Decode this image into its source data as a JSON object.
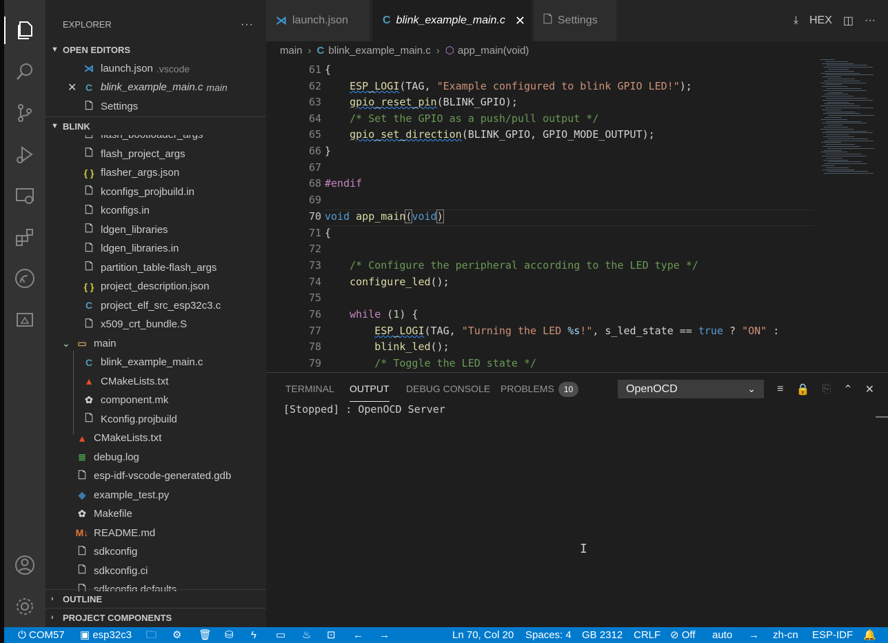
{
  "explorer": {
    "title": "EXPLORER",
    "more": "···"
  },
  "open_editors": {
    "header": "OPEN EDITORS",
    "items": [
      {
        "name": "launch.json",
        "detail": ".vscode"
      },
      {
        "name": "blink_example_main.c",
        "detail": "main"
      },
      {
        "name": "Settings",
        "detail": ""
      }
    ]
  },
  "blink": {
    "header": "BLINK",
    "items": [
      {
        "name": "flash_bootloader_args",
        "icon": "file-icon"
      },
      {
        "name": "flash_project_args",
        "icon": "file-icon"
      },
      {
        "name": "flasher_args.json",
        "icon": "json-icon"
      },
      {
        "name": "kconfigs_projbuild.in",
        "icon": "file-icon"
      },
      {
        "name": "kconfigs.in",
        "icon": "file-icon"
      },
      {
        "name": "ldgen_libraries",
        "icon": "file-icon"
      },
      {
        "name": "ldgen_libraries.in",
        "icon": "file-icon"
      },
      {
        "name": "partition_table-flash_args",
        "icon": "file-icon"
      },
      {
        "name": "project_description.json",
        "icon": "json-icon"
      },
      {
        "name": "project_elf_src_esp32c3.c",
        "icon": "c-icon"
      },
      {
        "name": "x509_crt_bundle.S",
        "icon": "file-icon"
      },
      {
        "name": "main",
        "icon": "folder-icon"
      },
      {
        "name": "blink_example_main.c",
        "icon": "c-icon"
      },
      {
        "name": "CMakeLists.txt",
        "icon": "cmake-icon"
      },
      {
        "name": "component.mk",
        "icon": "make-icon"
      },
      {
        "name": "Kconfig.projbuild",
        "icon": "file-icon"
      },
      {
        "name": "CMakeLists.txt",
        "icon": "cmake-icon"
      },
      {
        "name": "debug.log",
        "icon": "log-icon"
      },
      {
        "name": "esp-idf-vscode-generated.gdb",
        "icon": "file-icon"
      },
      {
        "name": "example_test.py",
        "icon": "python-icon"
      },
      {
        "name": "Makefile",
        "icon": "make-icon"
      },
      {
        "name": "README.md",
        "icon": "markdown-icon"
      },
      {
        "name": "sdkconfig",
        "icon": "file-icon"
      },
      {
        "name": "sdkconfig.ci",
        "icon": "file-icon"
      },
      {
        "name": "sdkconfig.defaults",
        "icon": "file-icon"
      }
    ]
  },
  "outline": {
    "header": "OUTLINE"
  },
  "project_components": {
    "header": "PROJECT COMPONENTS"
  },
  "tabs": [
    {
      "label": "launch.json"
    },
    {
      "label": "blink_example_main.c",
      "close": "✕"
    },
    {
      "label": "Settings"
    }
  ],
  "tab_actions": {
    "hex": "HEX",
    "more": "···"
  },
  "breadcrumbs": {
    "folder": "main",
    "file": "blink_example_main.c",
    "symbol": "app_main(void)",
    "sep": "›"
  },
  "editor": {
    "line_numbers": [
      "61",
      "62",
      "63",
      "64",
      "65",
      "66",
      "67",
      "68",
      "69",
      "70",
      "71",
      "72",
      "73",
      "74",
      "75",
      "76",
      "77",
      "78",
      "79"
    ],
    "current_line": "70"
  },
  "panel": {
    "tabs": [
      "TERMINAL",
      "OUTPUT",
      "DEBUG CONSOLE",
      "PROBLEMS"
    ],
    "problems_count": "10",
    "output_channel": "OpenOCD",
    "output_text": "[Stopped] : OpenOCD Server"
  },
  "statusbar": {
    "port": "COM57",
    "target": "esp32c3",
    "position": "Ln 70, Col 20",
    "spaces": "Spaces: 4",
    "encoding": "GB 2312",
    "eol": "CRLF",
    "off": "Off",
    "auto": "auto",
    "lang": "zh-cn",
    "mode": "ESP-IDF"
  },
  "colors": {
    "accent": "#007acc",
    "activity_bar": "#333333",
    "sidebar": "#252526",
    "editor": "#1e1e1e"
  }
}
